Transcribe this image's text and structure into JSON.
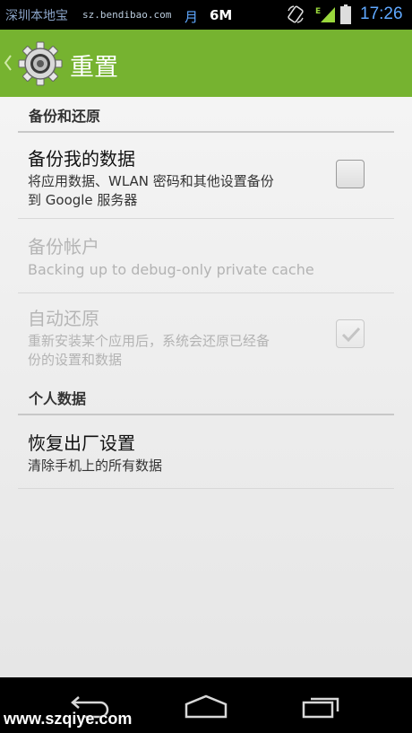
{
  "status_bar": {
    "watermark_site": "深圳本地宝",
    "watermark_url": "sz.bendibao.com",
    "month_char": "月",
    "data_size": "6M",
    "network_type": "E",
    "time": "17:26",
    "accent_color": "#5fa8ff",
    "icons": [
      "rotation-lock-icon",
      "signal-icon",
      "battery-icon"
    ]
  },
  "action_bar": {
    "title": "重置",
    "color": "#76b330",
    "icon": "settings-gear-icon"
  },
  "sections": [
    {
      "header": "备份和还原",
      "items": [
        {
          "title": "备份我的数据",
          "summary_lines": [
            "将应用数据、WLAN 密码和其他设置备份",
            "到 Google 服务器"
          ],
          "enabled": true,
          "checkbox": {
            "checked": false
          }
        },
        {
          "title": "备份帐户",
          "summary_lines": [
            "Backing up to debug-only private cache"
          ],
          "enabled": false
        },
        {
          "title": "自动还原",
          "summary_lines": [
            "重新安装某个应用后，系统会还原已经备",
            "份的设置和数据"
          ],
          "enabled": false,
          "checkbox": {
            "checked": true
          }
        }
      ]
    },
    {
      "header": "个人数据",
      "items": [
        {
          "title": "恢复出厂设置",
          "summary_lines": [
            "清除手机上的所有数据"
          ],
          "enabled": true
        }
      ]
    }
  ],
  "nav_bar": {
    "buttons": [
      "back-icon",
      "home-icon",
      "recent-apps-icon"
    ],
    "watermark": "www.szqiye.com"
  }
}
